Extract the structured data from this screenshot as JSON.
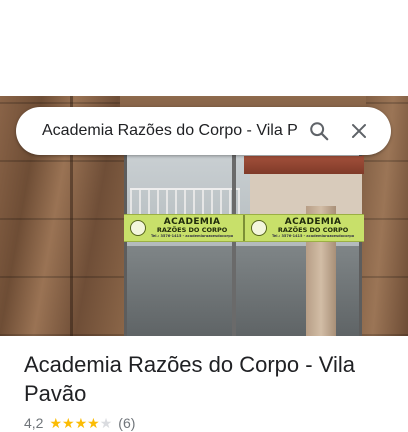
{
  "search": {
    "value": "Academia Razões do Corpo - Vila Pavão",
    "search_icon": "search-icon",
    "clear_icon": "close-icon"
  },
  "photo": {
    "sign_panels": [
      {
        "title": "ACADEMIA",
        "subtitle": "RAZÕES DO CORPO",
        "phone": "Tel.: 3576-1415 - academiarazoesdocorpo"
      },
      {
        "title": "ACADEMIA",
        "subtitle": "RAZÕES DO CORPO",
        "phone": "Tel.: 3576-1415 - academiarazoesdocorpo"
      }
    ]
  },
  "place": {
    "name": "Academia Razões do Corpo - Vila Pavão",
    "rating": "4,2",
    "rating_value": 4.2,
    "stars_filled": 4,
    "stars_total": 5,
    "review_count": "(6)"
  },
  "colors": {
    "star_filled": "#fbbc04",
    "star_empty": "#dadce0",
    "title_text": "#202124",
    "secondary_text": "#70757a"
  }
}
